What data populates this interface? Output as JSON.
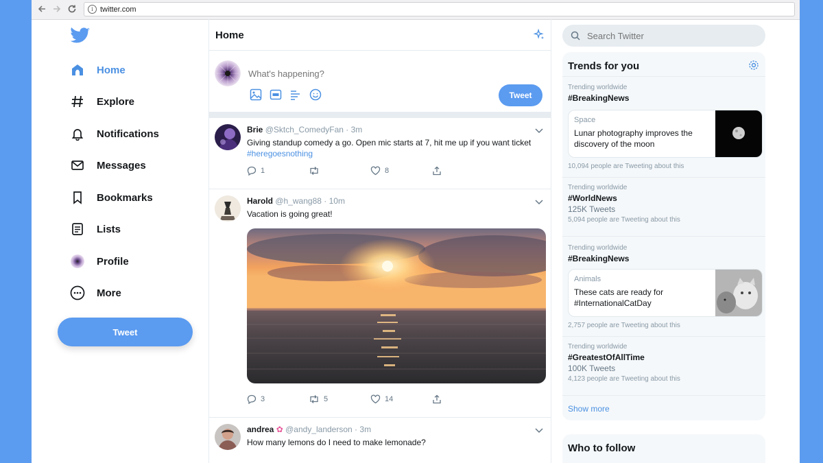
{
  "browser": {
    "url": "twitter.com"
  },
  "nav": {
    "items": [
      {
        "label": "Home",
        "icon": "home-icon"
      },
      {
        "label": "Explore",
        "icon": "hashtag-icon"
      },
      {
        "label": "Notifications",
        "icon": "bell-icon"
      },
      {
        "label": "Messages",
        "icon": "envelope-icon"
      },
      {
        "label": "Bookmarks",
        "icon": "bookmark-icon"
      },
      {
        "label": "Lists",
        "icon": "list-icon"
      },
      {
        "label": "Profile",
        "icon": "avatar-icon"
      },
      {
        "label": "More",
        "icon": "more-circle-icon"
      }
    ],
    "tweet_label": "Tweet"
  },
  "header": {
    "title": "Home"
  },
  "composer": {
    "placeholder": "What's happening?",
    "tweet_label": "Tweet"
  },
  "tweets": [
    {
      "name": "Brie",
      "handle": "@Sktch_ComedyFan",
      "time": "3m",
      "text": "Giving standup comedy a go. Open mic starts at 7, hit me up if you want ticket",
      "hashtag": "#heregoesnothing",
      "replies": "1",
      "retweets": "",
      "likes": "8"
    },
    {
      "name": "Harold",
      "handle": "@h_wang88",
      "time": "10m",
      "text": "Vacation is going great!",
      "replies": "3",
      "retweets": "5",
      "likes": "14"
    },
    {
      "name": "andrea",
      "handle": "@andy_landerson",
      "time": "3m",
      "text": "How many lemons do I need to make lemonade?"
    }
  ],
  "search": {
    "placeholder": "Search Twitter"
  },
  "trends": {
    "title": "Trends for you",
    "items": [
      {
        "context": "Trending worldwide",
        "name": "#BreakingNews",
        "card": {
          "category": "Space",
          "text": "Lunar photography improves the discovery of the moon"
        },
        "people": "10,094 people are Tweeting about this"
      },
      {
        "context": "Trending worldwide",
        "name": "#WorldNews",
        "count": "125K Tweets",
        "people": "5,094 people are Tweeting about this"
      },
      {
        "context": "Trending worldwide",
        "name": "#BreakingNews",
        "card": {
          "category": "Animals",
          "text": "These cats are ready for #InternationalCatDay"
        },
        "people": "2,757 people are Tweeting about this"
      },
      {
        "context": "Trending worldwide",
        "name": "#GreatestOfAllTime",
        "count": "100K Tweets",
        "people": "4,123 people are Tweeting about this"
      }
    ],
    "show_more": "Show more"
  },
  "who_to_follow": {
    "title": "Who to follow"
  },
  "colors": {
    "accent": "#5b9bf0",
    "background": "#5c9cf0",
    "text": "#14171a",
    "muted": "#8899a6"
  }
}
